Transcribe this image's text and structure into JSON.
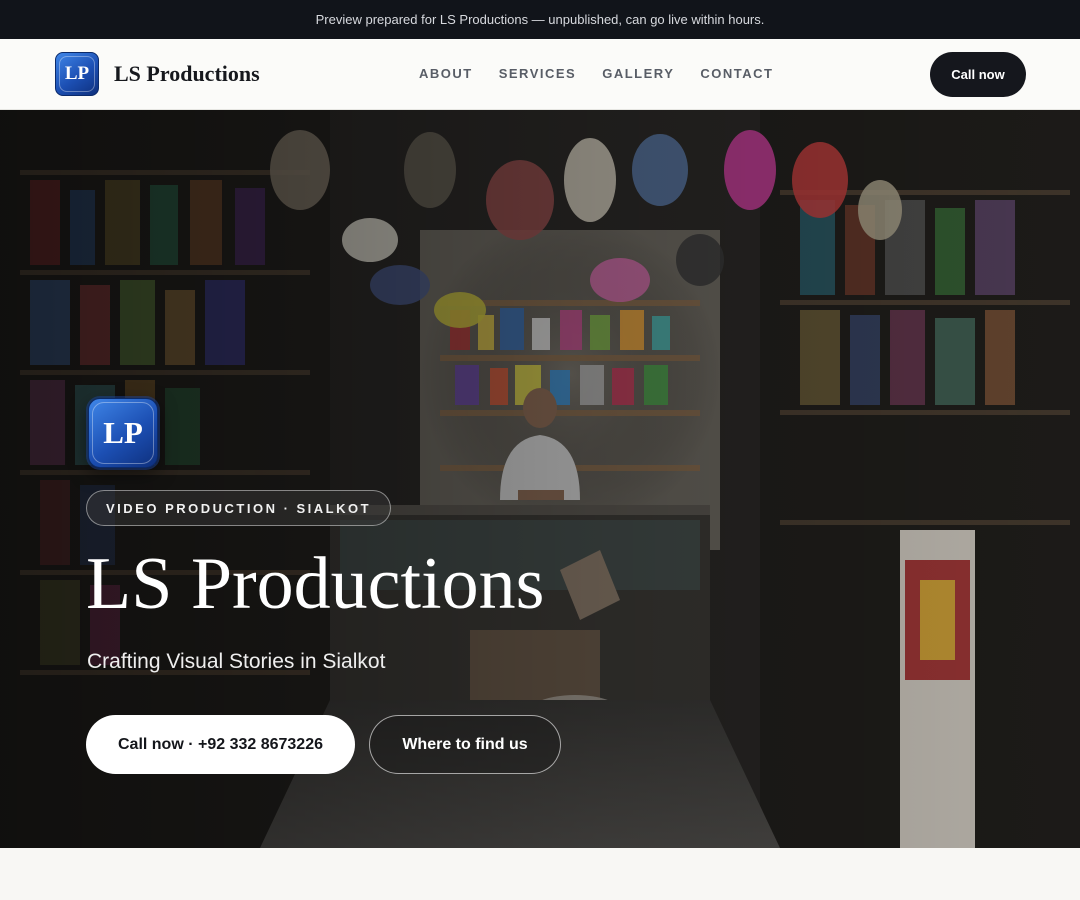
{
  "topbar": {
    "notice": "Preview prepared for LS Productions — unpublished, can go live within hours."
  },
  "brand": {
    "logo_text": "LP",
    "name": "LS Productions"
  },
  "nav": {
    "links": [
      "ABOUT",
      "SERVICES",
      "GALLERY",
      "CONTACT"
    ],
    "cta_label": "Call now"
  },
  "hero": {
    "logo_text": "LP",
    "tagline": "VIDEO PRODUCTION · SIALKOT",
    "title": "LS Productions",
    "subtitle": "Crafting Visual Stories in Sialkot",
    "primary_cta": "Call now · +92 332 8673226",
    "secondary_cta": "Where to find us"
  },
  "colors": {
    "topbar_bg": "#11141a",
    "nav_bg": "#fbfbf9",
    "cta_dark": "#15171d",
    "logo_blue": "#1c4fb3",
    "page_bg": "#f8f7f4"
  }
}
